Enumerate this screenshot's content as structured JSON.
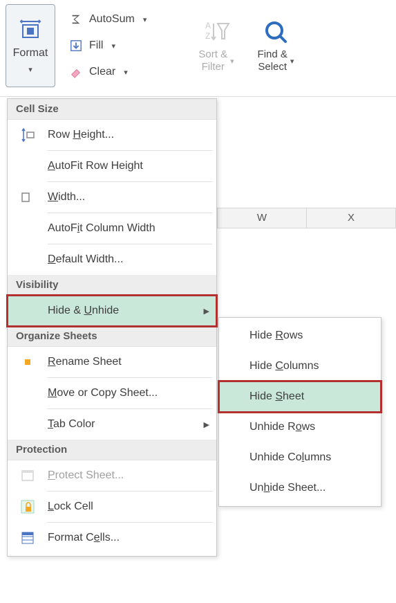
{
  "ribbon": {
    "format_label": "Format",
    "autosum_label": "AutoSum",
    "fill_label": "Fill",
    "clear_label": "Clear",
    "sort_filter_label_l1": "Sort &",
    "sort_filter_label_l2": "Filter",
    "find_select_label_l1": "Find &",
    "find_select_label_l2": "Select"
  },
  "columns": {
    "w": "W",
    "x": "X"
  },
  "menu": {
    "hdr_cell_size": "Cell Size",
    "row_height_pre": "Row ",
    "row_height_u": "H",
    "row_height_post": "eight...",
    "autofit_row_pre": "",
    "autofit_row_u": "A",
    "autofit_row_post": "utoFit Row Height",
    "width_u": "W",
    "width_post": "idth...",
    "autofit_col_pre": "AutoF",
    "autofit_col_u": "i",
    "autofit_col_post": "t Column Width",
    "default_width_u": "D",
    "default_width_post": "efault Width...",
    "hdr_visibility": "Visibility",
    "hide_unhide_pre": "Hide & ",
    "hide_unhide_u": "U",
    "hide_unhide_post": "nhide",
    "hdr_organize": "Organize Sheets",
    "rename_u": "R",
    "rename_post": "ename Sheet",
    "move_copy_pre": "",
    "move_copy_u": "M",
    "move_copy_post": "ove or Copy Sheet...",
    "tab_color_u": "T",
    "tab_color_post": "ab Color",
    "hdr_protection": "Protection",
    "protect_u": "P",
    "protect_post": "rotect Sheet...",
    "lock_u": "L",
    "lock_post": "ock Cell",
    "format_cells_pre": "Format C",
    "format_cells_u": "e",
    "format_cells_post": "lls..."
  },
  "submenu": {
    "hide_rows_pre": "Hide ",
    "hide_rows_u": "R",
    "hide_rows_post": "ows",
    "hide_cols_pre": "Hide ",
    "hide_cols_u": "C",
    "hide_cols_post": "olumns",
    "hide_sheet_pre": "Hide ",
    "hide_sheet_u": "S",
    "hide_sheet_post": "heet",
    "unhide_rows_pre": "Unhide R",
    "unhide_rows_u": "o",
    "unhide_rows_post": "ws",
    "unhide_cols_pre": "Unhide Co",
    "unhide_cols_u": "l",
    "unhide_cols_post": "umns",
    "unhide_sheet_pre": "Un",
    "unhide_sheet_u": "h",
    "unhide_sheet_post": "ide Sheet..."
  }
}
